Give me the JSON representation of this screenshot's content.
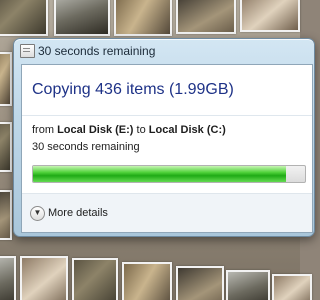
{
  "dialog": {
    "title": "30 seconds remaining",
    "heading": "Copying 436 items (1.99GB)",
    "from_prefix": "from ",
    "source": "Local Disk (E:)",
    "to_word": " to ",
    "destination": "Local Disk (C:)",
    "time_remaining": "30 seconds remaining",
    "progress_fraction": 0.93,
    "progress_color": "#35c92a",
    "more_details_label": "More details",
    "title_icon": "copy-window-icon",
    "more_details_icon": "chevron-down-icon"
  }
}
